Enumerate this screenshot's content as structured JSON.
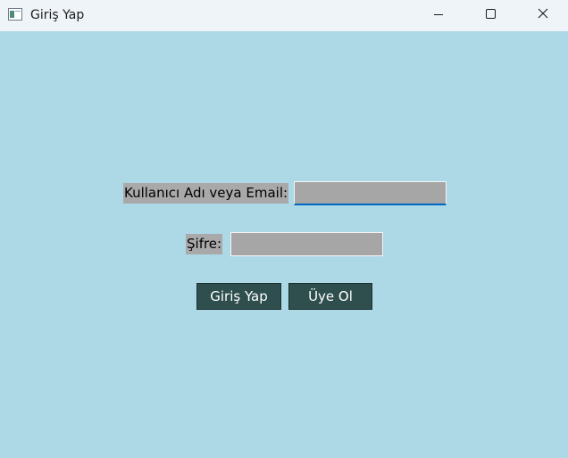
{
  "window": {
    "title": "Giriş Yap",
    "background_color": "#add8e6",
    "icon": "app-window-icon",
    "controls": {
      "minimize_icon": "minimize-icon",
      "maximize_icon": "maximize-icon",
      "close_icon": "close-icon"
    }
  },
  "form": {
    "username_label": "Kullanıcı Adı veya Email:",
    "username_value": "",
    "password_label": "Şifre:",
    "password_value": "",
    "label_background": "#a9a9a9",
    "field_background": "#a6a6a6"
  },
  "buttons": {
    "login_label": "Giriş Yap",
    "signup_label": "Üye Ol",
    "button_color": "#2f4f4f"
  }
}
